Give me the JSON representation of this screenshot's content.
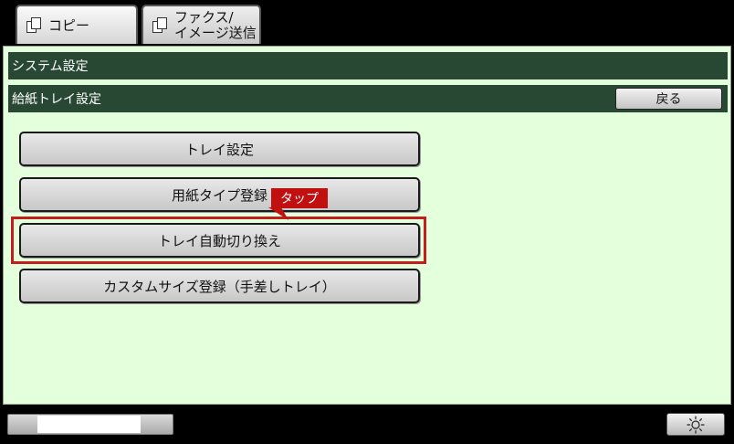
{
  "tabs": {
    "copy": {
      "label": "コピー",
      "icon": "copy-icon"
    },
    "fax": {
      "label": "ファクス/\nイメージ送信",
      "icon": "fax-scan-icon"
    }
  },
  "header": {
    "system_title": "システム設定",
    "tray_title": "給紙トレイ設定",
    "back_label": "戻る"
  },
  "menu": {
    "tray_settings": "トレイ設定",
    "paper_type": "用紙タイプ登録",
    "auto_switch": "トレイ自動切り換え",
    "custom_size": "カスタムサイズ登録（手差しトレイ）"
  },
  "annotation": {
    "tap": "タップ",
    "color": "#c01010"
  },
  "colors": {
    "panel_bg": "#e4ffdc",
    "header_bar": "#284834",
    "highlight": "#c21e1e"
  },
  "footer": {
    "brightness_icon": "sun-icon"
  }
}
